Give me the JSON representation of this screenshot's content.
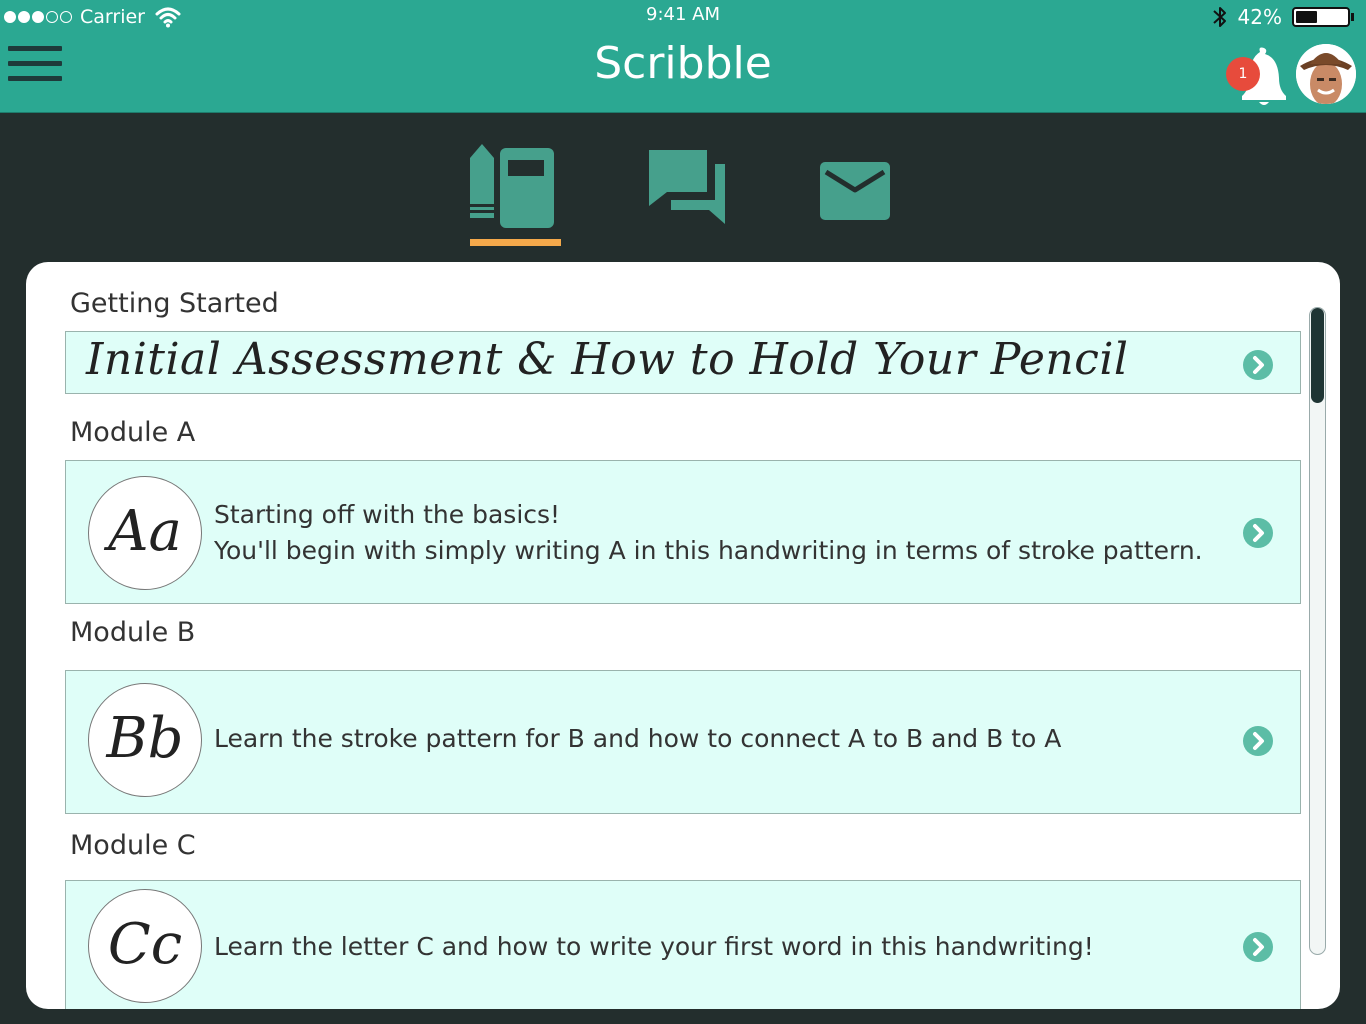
{
  "status_bar": {
    "carrier": "Carrier",
    "time": "9:41 AM",
    "battery_percent": "42%",
    "battery_level": 0.42,
    "signal_bars": 3,
    "signal_bars_total": 5
  },
  "header": {
    "title": "Scribble",
    "notification_count": "1",
    "icons": [
      "menu-icon",
      "bell-icon",
      "avatar"
    ]
  },
  "tabs": [
    {
      "name": "courses",
      "icon": "notebook-pencil-icon",
      "active": true
    },
    {
      "name": "chat",
      "icon": "chat-bubbles-icon",
      "active": false
    },
    {
      "name": "mail",
      "icon": "envelope-icon",
      "active": false
    }
  ],
  "sections": [
    {
      "label": "Getting Started",
      "title": "Initial Assessment & How to Hold Your Pencil"
    },
    {
      "label": "Module A",
      "badge": "Aa",
      "lines": [
        "Starting off with the basics!",
        "You'll begin with simply writing A in this handwriting in terms of stroke pattern."
      ]
    },
    {
      "label": "Module B",
      "badge": "Bb",
      "lines": [
        "Learn the stroke pattern for B and how to connect A to B and B to A"
      ]
    },
    {
      "label": "Module C",
      "badge": "Cc",
      "lines": [
        "Learn the letter C and how to write your first word in this handwriting!"
      ]
    }
  ],
  "colors": {
    "header": "#2ba892",
    "background": "#232e2d",
    "row_background": "#dffef8",
    "active_tab_indicator": "#f4a94b",
    "tab_icon": "#46a08c",
    "notification_badge": "#e74b3c"
  }
}
